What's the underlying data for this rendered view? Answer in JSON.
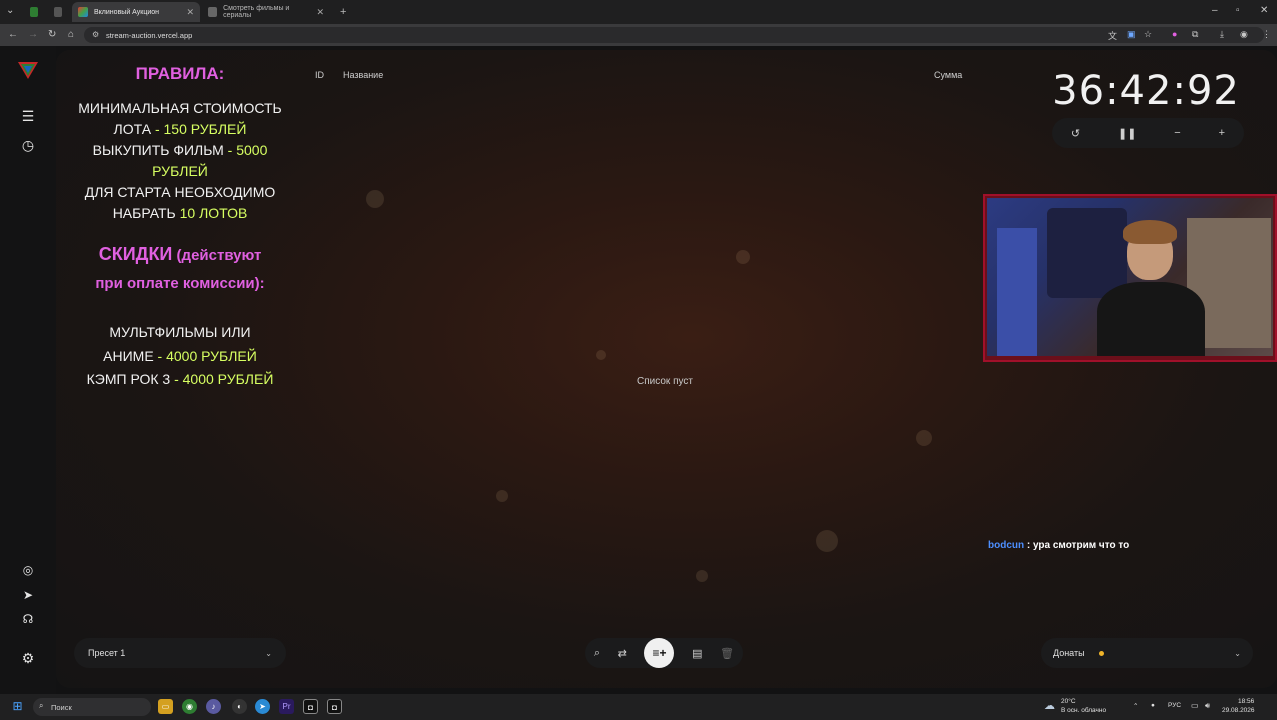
{
  "browser": {
    "tabs": [
      {
        "label": "Вклиновый Аукцион",
        "active": true
      },
      {
        "label": "Смотреть фильмы и сериалы",
        "active": false
      }
    ],
    "new_tab": "+",
    "url": "stream-auction.vercel.app"
  },
  "rules": {
    "title": "ПРАВИЛА:",
    "min_cost_a": "МИНИМАЛЬНАЯ СТОИМОСТЬ",
    "min_cost_b": "ЛОТА",
    "min_cost_value": "- 150 РУБЛЕЙ",
    "buyout_a": "ВЫКУПИТЬ ФИЛЬМ",
    "buyout_value_a": "- 5000",
    "buyout_value_b": "РУБЛЕЙ",
    "start_a": "ДЛЯ СТАРТА НЕОБХОДИМО",
    "start_b": "НАБРАТЬ",
    "start_value": "10 ЛОТОВ",
    "discounts_title": "СКИДКИ",
    "discounts_note_a": "(действуют",
    "discounts_note_b": "при оплате комиссии):",
    "cartoons_a": "МУЛЬТФИЛЬМЫ ИЛИ",
    "cartoons_b": "АНИМЕ",
    "cartoons_value": "- 4000 РУБЛЕЙ",
    "camp_a": "КЭМП РОК 3",
    "camp_value": "- 4000 РУБЛЕЙ"
  },
  "table": {
    "col_id": "ID",
    "col_name": "Название",
    "col_sum": "Сумма",
    "empty": "Список пуст"
  },
  "timer": {
    "hours": "36",
    "minutes": "42",
    "seconds": "92",
    "sep": ":"
  },
  "chat": {
    "user": "bodcun",
    "message": " : ура смотрим что то"
  },
  "preset": {
    "label": "Пресет 1"
  },
  "donates": {
    "label": "Донаты"
  },
  "taskbar": {
    "search": "Поиск",
    "weather_temp": "20°C",
    "weather_desc": "В осн. облачно",
    "lang": "РУС",
    "time": "18:56",
    "date": "29.08.2026"
  },
  "colors": {
    "accent_pink": "#e060e0",
    "accent_lime": "#d7ff62",
    "chat_user": "#4d8fff",
    "donates_dot": "#f0b429"
  }
}
